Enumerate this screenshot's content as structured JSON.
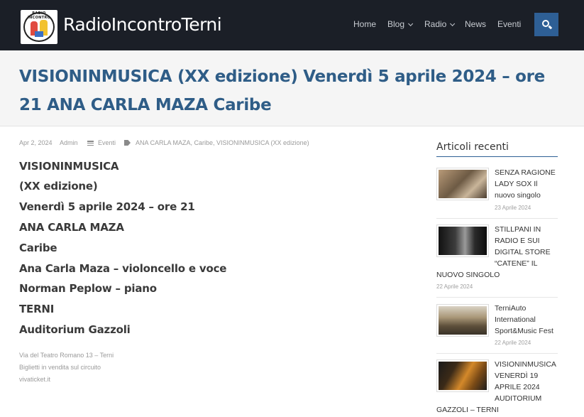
{
  "header": {
    "site_title": "RadioIncontroTerni",
    "logo_text": "RADIO INCONTRO",
    "nav": [
      {
        "label": "Home",
        "has_dropdown": false
      },
      {
        "label": "Blog",
        "has_dropdown": true
      },
      {
        "label": "Radio",
        "has_dropdown": true
      },
      {
        "label": "News",
        "has_dropdown": false
      },
      {
        "label": "Eventi",
        "has_dropdown": false
      }
    ],
    "search_icon": "search-icon"
  },
  "post": {
    "title": "VISIONINMUSICA (XX edizione) Venerdì 5 aprile 2024 – ore 21 ANA CARLA MAZA Caribe",
    "meta": {
      "date": "Apr 2, 2024",
      "author": "Admin",
      "category": "Eventi",
      "tags": "ANA CARLA MAZA, Caribe, VISIONINMUSICA (XX edizione)"
    },
    "body_lines": [
      "VISIONINMUSICA",
      "(XX edizione)",
      "Venerdì 5 aprile 2024 – ore 21",
      "ANA CARLA MAZA",
      "Caribe",
      "Ana Carla Maza – violoncello e voce",
      "Norman Peplow – piano",
      "TERNI",
      "Auditorium Gazzoli"
    ],
    "small_lines": [
      "Via del Teatro Romano 13 – Terni",
      "Biglietti in vendita sul circuito",
      "vivaticket.it"
    ]
  },
  "sidebar": {
    "heading": "Articoli recenti",
    "posts": [
      {
        "title_line1": "SENZA RAGIONE",
        "title_rest": "LADY SOX Il nuovo singolo",
        "date": "23 Aprile 2024",
        "thumb_color": "#8f7356"
      },
      {
        "title_line1": "STILLPANI  IN",
        "title_rest": "RADIO E SUI DIGITAL STORE “CATENE” IL",
        "title_tail": "NUOVO SINGOLO",
        "date": "22 Aprile 2024",
        "thumb_color": "#2a2a2a"
      },
      {
        "title_line1": "TerniAuto",
        "title_rest": "International Sport&Music Fest",
        "date": "22 Aprile 2024",
        "thumb_color": "#7a6a52"
      },
      {
        "title_line1": "VISIONINMUSICA",
        "title_rest": "VENERDÌ 19 APRILE 2024 AUDITORIUM",
        "title_tail": "GAZZOLI – TERNI",
        "thumb_color": "#c6781e"
      }
    ]
  }
}
